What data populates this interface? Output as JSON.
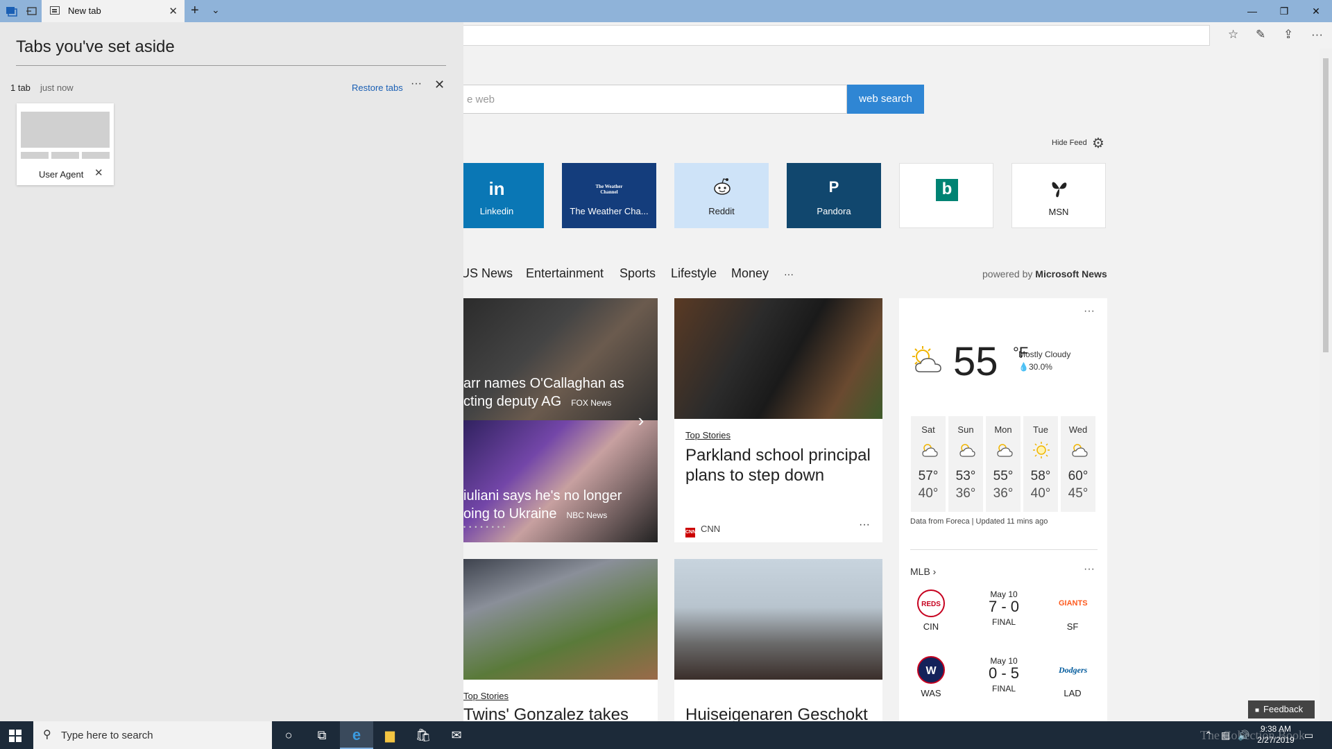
{
  "browser": {
    "tab_title": "New tab",
    "colors": {
      "titlebar": "#8fb3d9",
      "accent": "#2f86d4"
    }
  },
  "aside": {
    "title": "Tabs you've set aside",
    "count": "1 tab",
    "time": "just now",
    "restore_label": "Restore tabs",
    "more": "···",
    "close": "✕",
    "card_label": "User Agent"
  },
  "search": {
    "placeholder": "e web",
    "button": "web search"
  },
  "feed": {
    "hide_label": "Hide Feed"
  },
  "tiles": [
    {
      "logo": "in",
      "label": "Linkedin"
    },
    {
      "logo": "The Weather Channel",
      "label": "The Weather Cha..."
    },
    {
      "logo": "reddit-alien",
      "label": "Reddit"
    },
    {
      "logo": "P",
      "label": "Pandora"
    },
    {
      "logo": "b",
      "label": ""
    },
    {
      "logo": "butterfly",
      "label": "MSN"
    }
  ],
  "categories": [
    "US News",
    "Entertainment",
    "Sports",
    "Lifestyle",
    "Money",
    "···"
  ],
  "powered": {
    "prefix": "powered by",
    "brand": "Microsoft News"
  },
  "hero": {
    "story1": {
      "line1": "arr names O'Callaghan as",
      "line2": "cting deputy AG",
      "source": "FOX News"
    },
    "story2": {
      "line1": "iuliani says he's no longer",
      "line2": "oing to Ukraine",
      "source": "NBC News"
    },
    "dots": "••••••••"
  },
  "story_parkland": {
    "category": "Top Stories",
    "title": "Parkland school principal plans to step down",
    "source": "CNN",
    "more": "···"
  },
  "story_twins": {
    "category": "Top Stories",
    "title": "Twins' Gonzalez takes"
  },
  "story_dutch": {
    "title": "Huiseigenaren Geschokt"
  },
  "weather": {
    "more": "···",
    "temp": "55",
    "unit": "°F",
    "condition": "Mostly Cloudy",
    "precip": "30.0%",
    "forecast": [
      {
        "day": "Sat",
        "high": "57°",
        "low": "40°",
        "icon": "partly-cloudy"
      },
      {
        "day": "Sun",
        "high": "53°",
        "low": "36°",
        "icon": "partly-cloudy"
      },
      {
        "day": "Mon",
        "high": "55°",
        "low": "36°",
        "icon": "partly-cloudy"
      },
      {
        "day": "Tue",
        "high": "58°",
        "low": "40°",
        "icon": "sunny"
      },
      {
        "day": "Wed",
        "high": "60°",
        "low": "45°",
        "icon": "partly-cloudy"
      }
    ],
    "footer": "Data from Foreca | Updated 11 mins ago"
  },
  "mlb": {
    "title": "MLB ›",
    "more": "···",
    "games": [
      {
        "home": "CIN",
        "away": "SF",
        "date": "May 10",
        "score": "7 - 0",
        "status": "FINAL",
        "home_color": "#c6011f",
        "away_color": "#fd5a1e"
      },
      {
        "home": "WAS",
        "away": "LAD",
        "date": "May 10",
        "score": "0 - 5",
        "status": "FINAL",
        "home_color": "#14225a",
        "away_color": "#005a9c"
      }
    ]
  },
  "feedback": "Feedback",
  "taskbar": {
    "search_placeholder": "Type here to search",
    "watermark": "The Collection Book",
    "time": "9:38 AM",
    "date": "2/27/2019"
  }
}
